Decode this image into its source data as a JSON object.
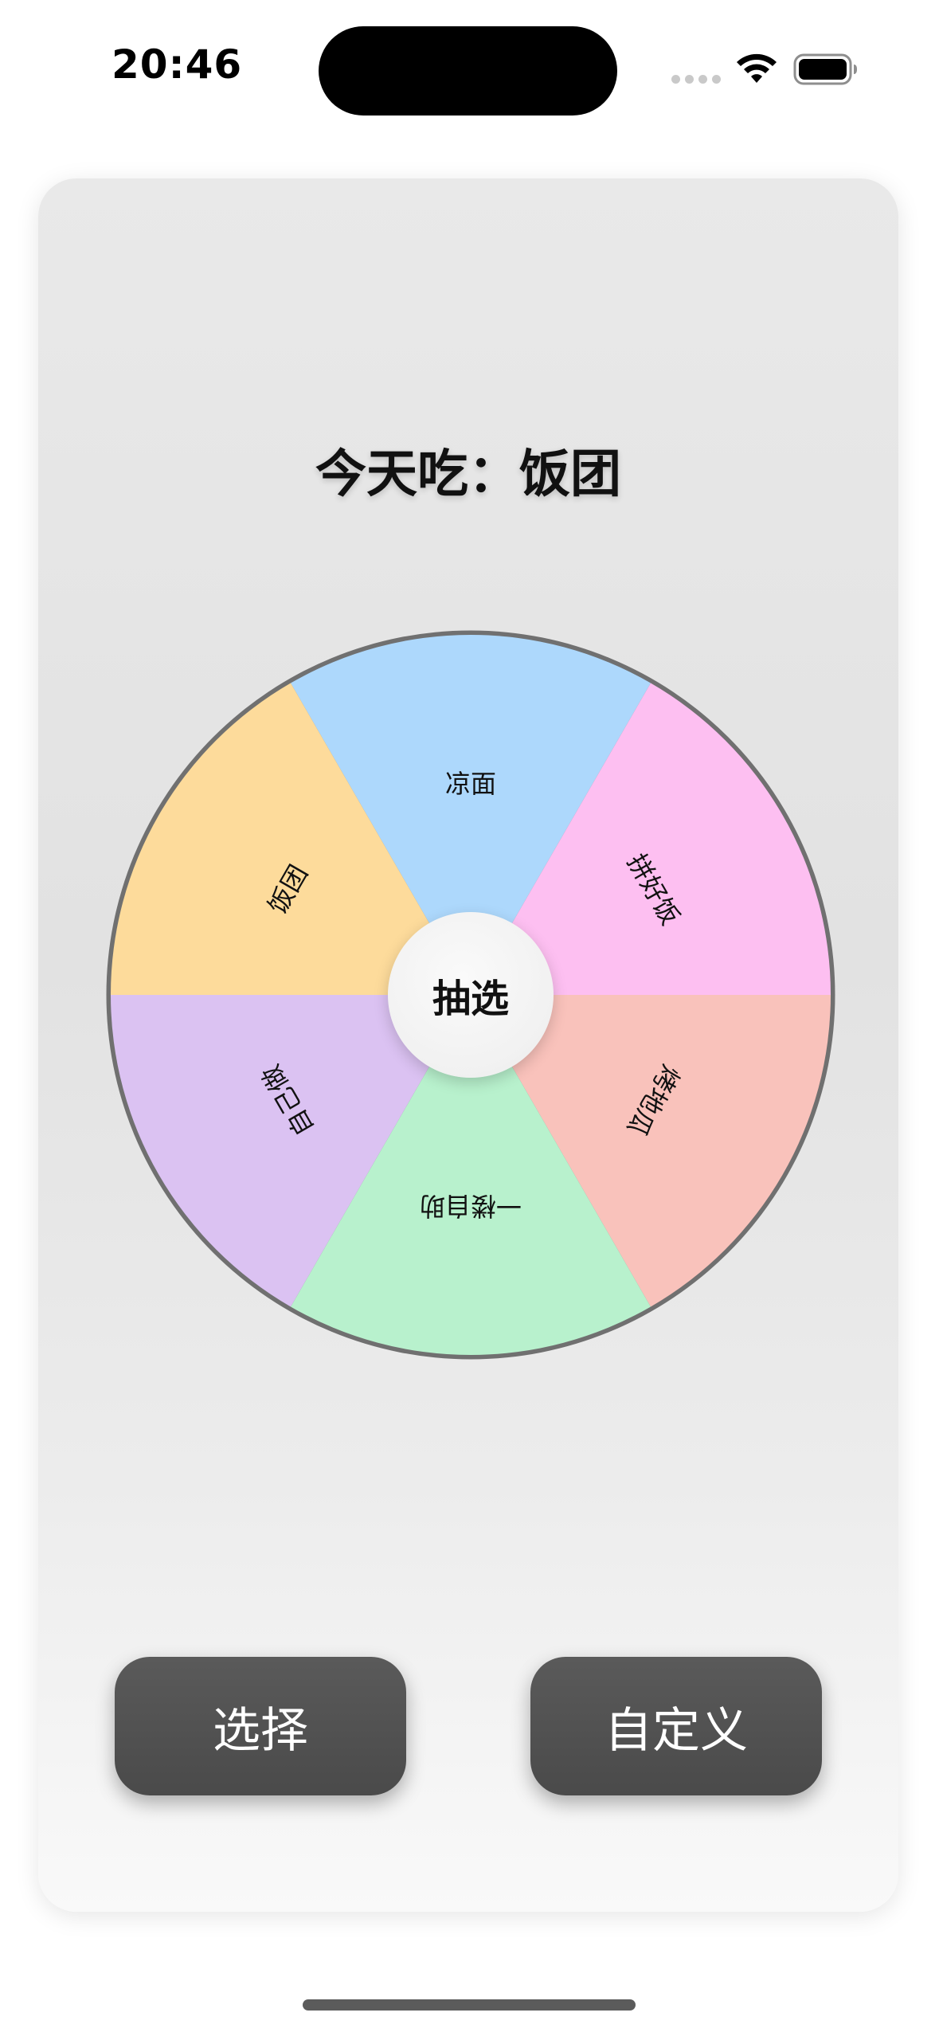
{
  "status_bar": {
    "time": "20:46",
    "icons": [
      "cellular-signal-icon",
      "wifi-icon",
      "battery-icon"
    ]
  },
  "card": {
    "result_text": "今天吃：饭团"
  },
  "wheel": {
    "center_button_label": "抽选",
    "segments": [
      {
        "label": "凉面",
        "color": "#add8fc"
      },
      {
        "label": "拼好饭",
        "color": "#fdbff1"
      },
      {
        "label": "烤地瓜",
        "color": "#f9c2bb"
      },
      {
        "label": "一楼自助",
        "color": "#b8f1cd"
      },
      {
        "label": "自己做",
        "color": "#dbc2f2"
      },
      {
        "label": "饭团",
        "color": "#fddb9b"
      }
    ],
    "rim_color": "#707070"
  },
  "buttons": {
    "select_label": "选择",
    "custom_label": "自定义"
  }
}
